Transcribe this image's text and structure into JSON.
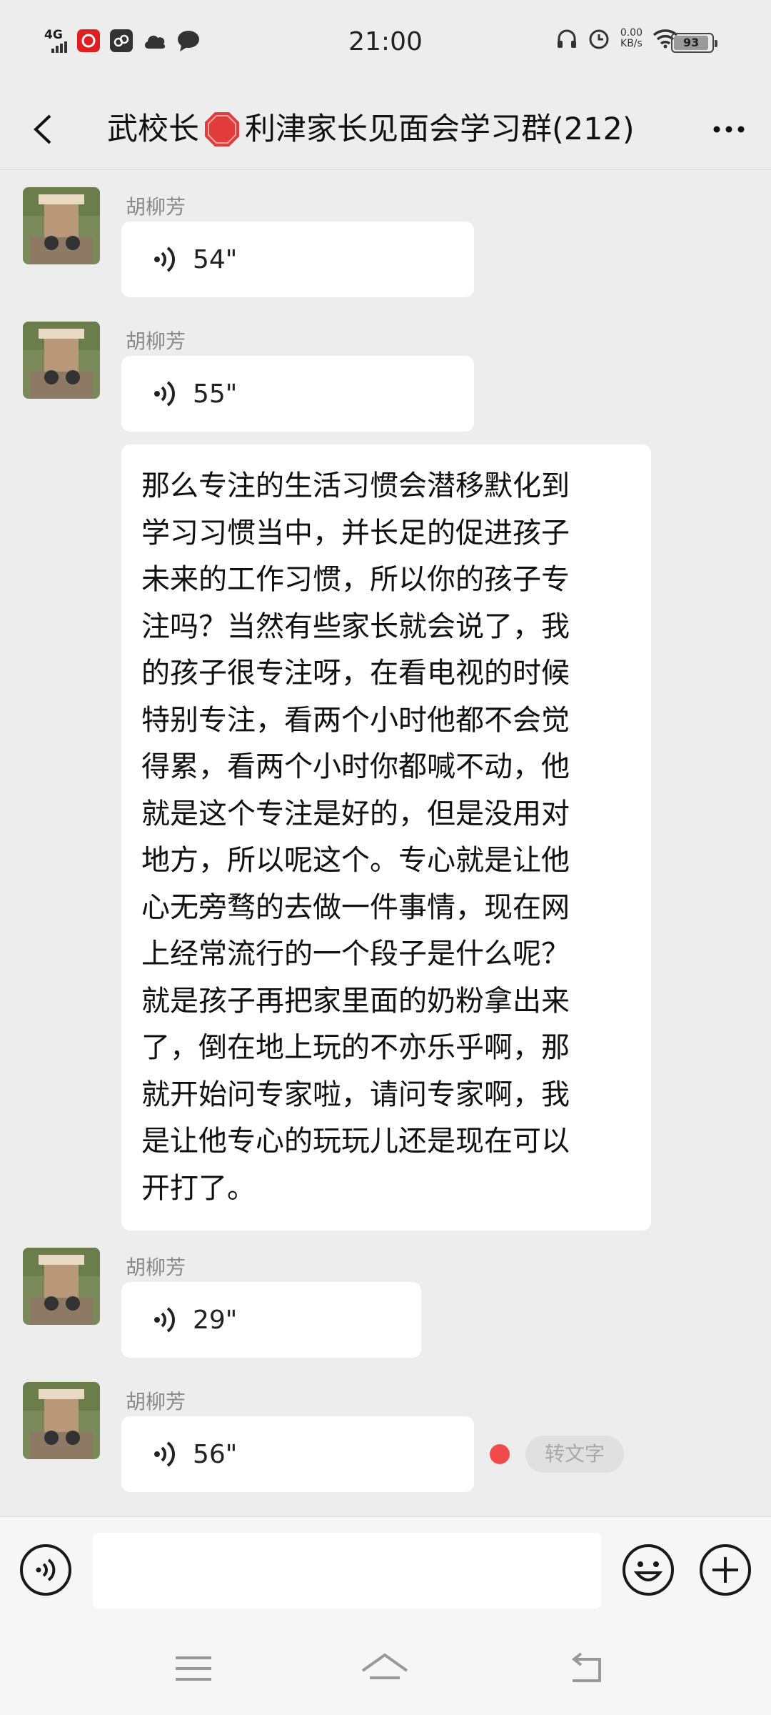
{
  "status_bar": {
    "time": "21:00",
    "network": "4G",
    "speed_value": "0.00",
    "speed_unit": "KB/s",
    "battery": "93"
  },
  "header": {
    "title_part1": "武校长",
    "title_part2": "利津家长见面会学习群(212)",
    "back_icon": "chevron-left-icon",
    "more_icon": "more-dots-icon"
  },
  "messages": [
    {
      "type": "voice",
      "sender": "胡柳芳",
      "duration": "54\""
    },
    {
      "type": "voice",
      "sender": "胡柳芳",
      "duration": "55\""
    },
    {
      "type": "text",
      "text": "那么专注的生活习惯会潜移默化到\n学习习惯当中，并长足的促进孩子\n未来的工作习惯，所以你的孩子专\n注吗？当然有些家长就会说了，我\n的孩子很专注呀，在看电视的时候\n特别专注，看两个小时他都不会觉\n得累，看两个小时你都喊不动，他\n就是这个专注是好的，但是没用对\n地方，所以呢这个。专心就是让他\n心无旁骛的去做一件事情，现在网\n上经常流行的一个段子是什么呢？\n就是孩子再把家里面的奶粉拿出来\n了，倒在地上玩的不亦乐乎啊，那\n就开始问专家啦，请问专家啊，我\n是让他专心的玩玩儿还是现在可以\n开打了。"
    },
    {
      "type": "voice",
      "sender": "胡柳芳",
      "duration": "29\""
    },
    {
      "type": "voice",
      "sender": "胡柳芳",
      "duration": "56\"",
      "convert_label": "转文字"
    }
  ],
  "input_bar": {
    "voice_icon": "voice-mode-icon",
    "emoji_icon": "emoji-icon",
    "plus_icon": "plus-icon"
  },
  "colors": {
    "background": "#ededed",
    "bubble": "#ffffff",
    "unread_dot": "#f24b4b"
  }
}
